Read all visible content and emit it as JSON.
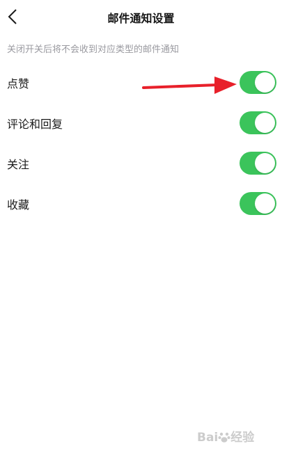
{
  "header": {
    "title": "邮件通知设置"
  },
  "hint": "关闭开关后将不会收到对应类型的邮件通知",
  "settings": [
    {
      "label": "点赞",
      "enabled": true
    },
    {
      "label": "评论和回复",
      "enabled": true
    },
    {
      "label": "关注",
      "enabled": true
    },
    {
      "label": "收藏",
      "enabled": true
    }
  ],
  "colors": {
    "toggle_on": "#3bc45b",
    "annotation_arrow": "#e8202a",
    "hint_text": "#9a9aa0"
  },
  "watermark": {
    "text_left": "Bai",
    "text_right": "经验"
  }
}
